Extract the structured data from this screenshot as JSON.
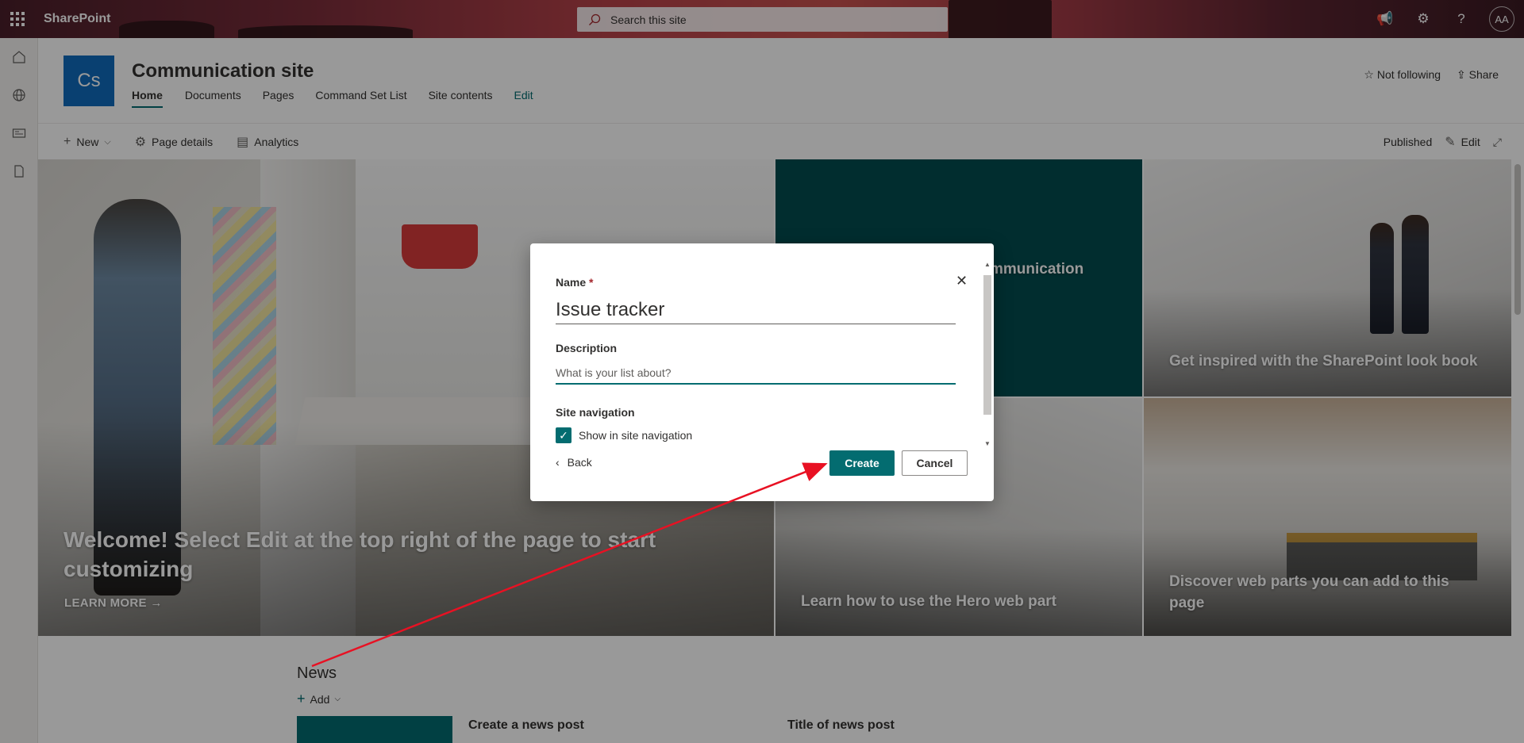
{
  "suite": {
    "brand": "SharePoint",
    "search_placeholder": "Search this site",
    "avatar_initials": "AA"
  },
  "site": {
    "logo_initials": "Cs",
    "title": "Communication site",
    "nav": [
      "Home",
      "Documents",
      "Pages",
      "Command Set List",
      "Site contents"
    ],
    "nav_edit": "Edit",
    "follow": "Not following",
    "share": "Share"
  },
  "commandbar": {
    "new": "New",
    "page_details": "Page details",
    "analytics": "Analytics",
    "status": "Published",
    "edit": "Edit"
  },
  "hero": {
    "main_title": "Welcome! Select Edit at the top right of the page to start customizing",
    "learn_more": "LEARN MORE",
    "teal_text": "mmunication",
    "tile_lookbook": "Get inspired with the SharePoint look book",
    "tile_hero": "Learn how to use the Hero web part",
    "tile_webparts": "Discover web parts you can add to this page"
  },
  "news": {
    "title": "News",
    "add": "Add",
    "item1": "Create a news post",
    "item2": "Title of news post"
  },
  "dialog": {
    "name_label": "Name",
    "required_mark": "*",
    "name_value": "Issue tracker",
    "description_label": "Description",
    "description_placeholder": "What is your list about?",
    "site_nav_label": "Site navigation",
    "show_in_nav": "Show in site navigation",
    "show_in_nav_checked": true,
    "back": "Back",
    "create": "Create",
    "cancel": "Cancel"
  },
  "colors": {
    "accent": "#036c70",
    "annotation": "#e81123"
  }
}
